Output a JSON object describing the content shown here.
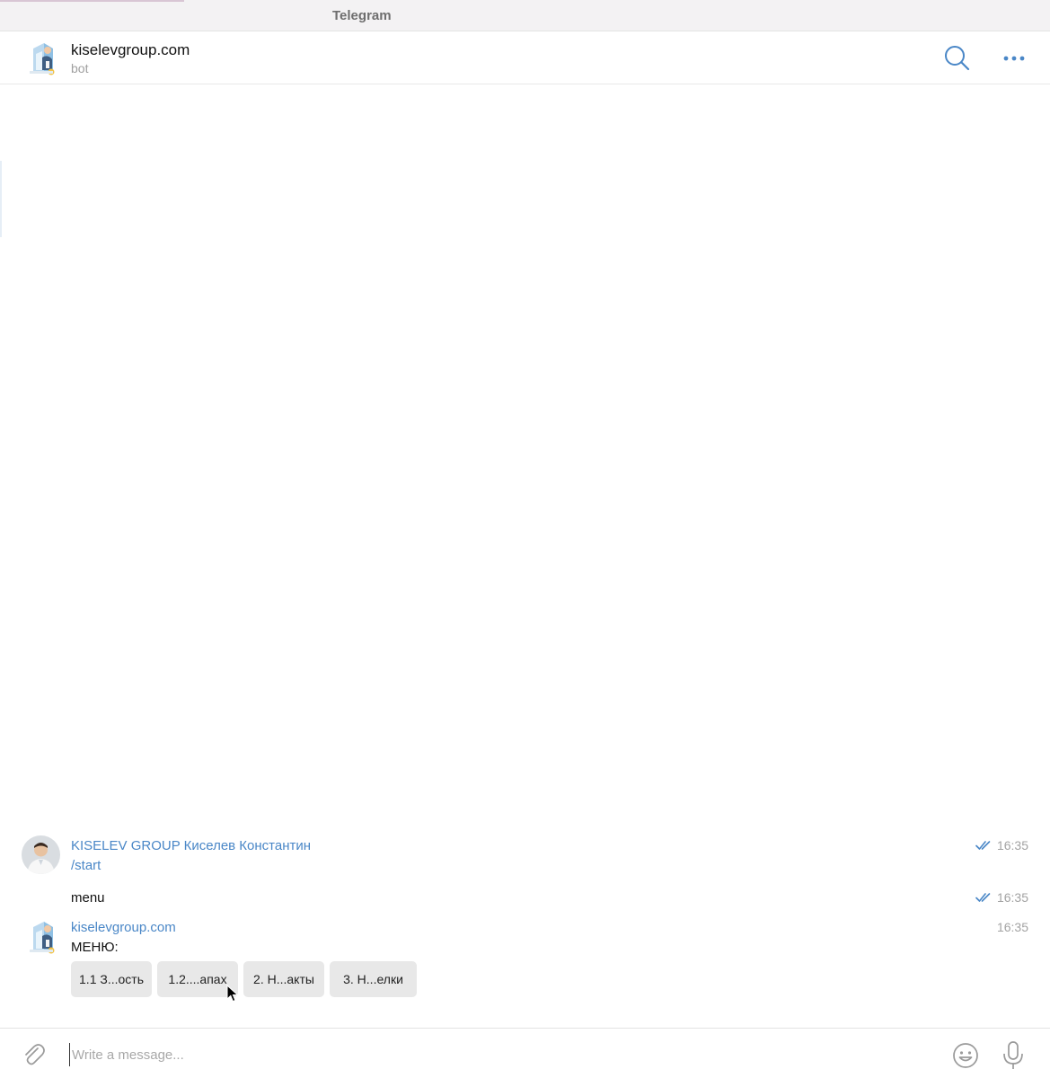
{
  "window": {
    "title": "Telegram"
  },
  "chat_header": {
    "name": "kiselevgroup.com",
    "status": "bot",
    "icons": {
      "avatar": "bot-avatar-icon",
      "search": "search-icon",
      "more": "more-dots-icon"
    }
  },
  "messages": [
    {
      "sender": "KISELEV GROUP Киселев Константин",
      "text": "/start",
      "time": "16:35",
      "read": true
    },
    {
      "text": "menu",
      "time": "16:35",
      "read": true
    },
    {
      "sender": "kiselevgroup.com",
      "text": "МЕНЮ:",
      "time": "16:35",
      "read": false,
      "inline_keyboard": [
        "1.1 З...ость",
        "1.2....апах",
        "2. Н...акты",
        "3. Н...елки"
      ]
    }
  ],
  "composer": {
    "placeholder": "Write a message...",
    "value": "",
    "icons": {
      "attach": "paperclip-icon",
      "emoji": "emoji-icon",
      "voice": "microphone-icon"
    }
  },
  "colors": {
    "accent": "#4a87c7",
    "meta": "#a3a3a3",
    "keyboard_button": "#e8e8e8"
  }
}
